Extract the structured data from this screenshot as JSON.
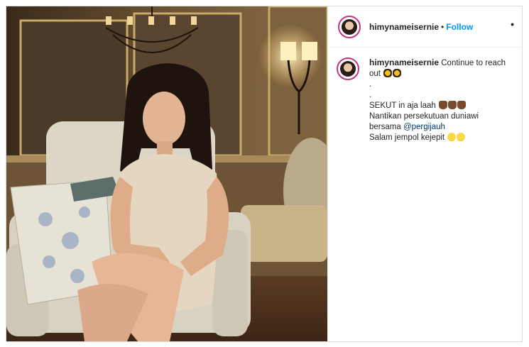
{
  "post": {
    "username": "himynameisernie",
    "separator": "•",
    "follow_label": "Follow",
    "more_icon": "more-options-icon"
  },
  "caption": {
    "username": "himynameisernie",
    "line1": "Continue to reach",
    "line2": "out",
    "dot1": ".",
    "dot2": ".",
    "line3": "SEKUT in aja laah",
    "line4": "Nantikan persekutuan duniawi",
    "line5_prefix": "bersama ",
    "mention": "@pergijauh",
    "line6": "Salam jempol kejepit"
  },
  "colors": {
    "link_blue": "#0095f6",
    "mention_blue": "#00376b",
    "story_ring": "#c13584"
  }
}
